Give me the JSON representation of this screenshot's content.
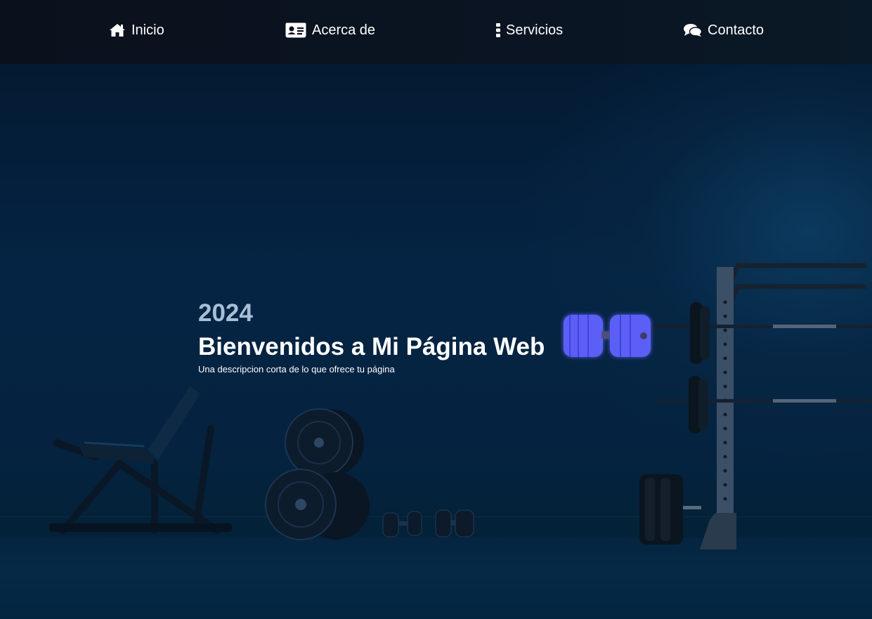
{
  "nav": {
    "items": [
      {
        "label": "Inicio",
        "icon": "home-icon"
      },
      {
        "label": "Acerca de",
        "icon": "id-card-icon"
      },
      {
        "label": "Servicios",
        "icon": "vertical-ellipsis-icon"
      },
      {
        "label": "Contacto",
        "icon": "chat-bubbles-icon"
      }
    ]
  },
  "hero": {
    "year": "2024",
    "title": "Bienvenidos a Mi Página Web",
    "description": "Una descripcion corta de lo que ofrece tu página"
  },
  "colors": {
    "navbar": "#0b111c",
    "background": "#052444",
    "year_text": "#a7bfd6",
    "dumbbell": "#5b5ff6"
  }
}
